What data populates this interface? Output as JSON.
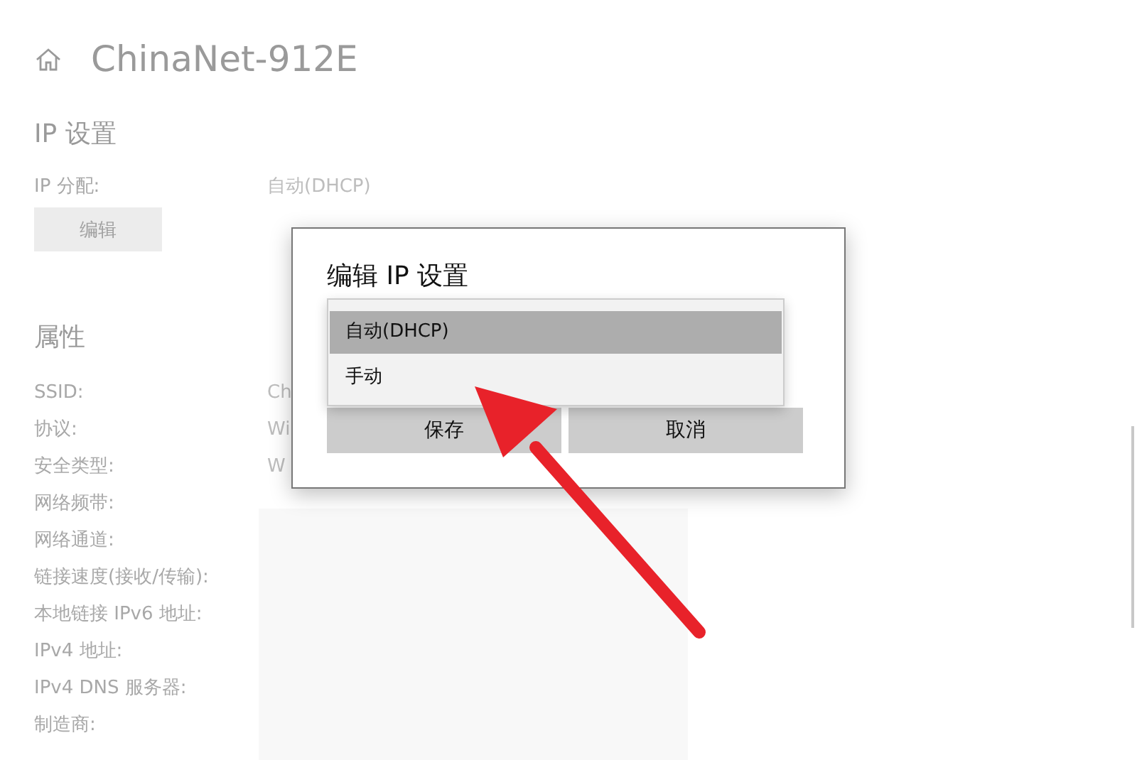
{
  "page": {
    "title": "ChinaNet-912E"
  },
  "ip_settings": {
    "heading": "IP 设置",
    "label": "IP 分配:",
    "value": "自动(DHCP)",
    "edit_button": "编辑"
  },
  "properties": {
    "heading": "属性",
    "rows": [
      {
        "label": "SSID:",
        "value": "Ch"
      },
      {
        "label": "协议:",
        "value": "Wi"
      },
      {
        "label": "安全类型:",
        "value": "W"
      },
      {
        "label": "网络频带:"
      },
      {
        "label": "网络通道:"
      },
      {
        "label": "链接速度(接收/传输):"
      },
      {
        "label": "本地链接 IPv6 地址:"
      },
      {
        "label": "IPv4 地址:"
      },
      {
        "label": "IPv4 DNS 服务器:"
      },
      {
        "label": "制造商:"
      }
    ]
  },
  "dialog": {
    "title": "编辑 IP 设置",
    "options": [
      {
        "label": "自动(DHCP)",
        "selected": true
      },
      {
        "label": "手动",
        "selected": false
      }
    ],
    "buttons": [
      "保存",
      "取消"
    ]
  }
}
